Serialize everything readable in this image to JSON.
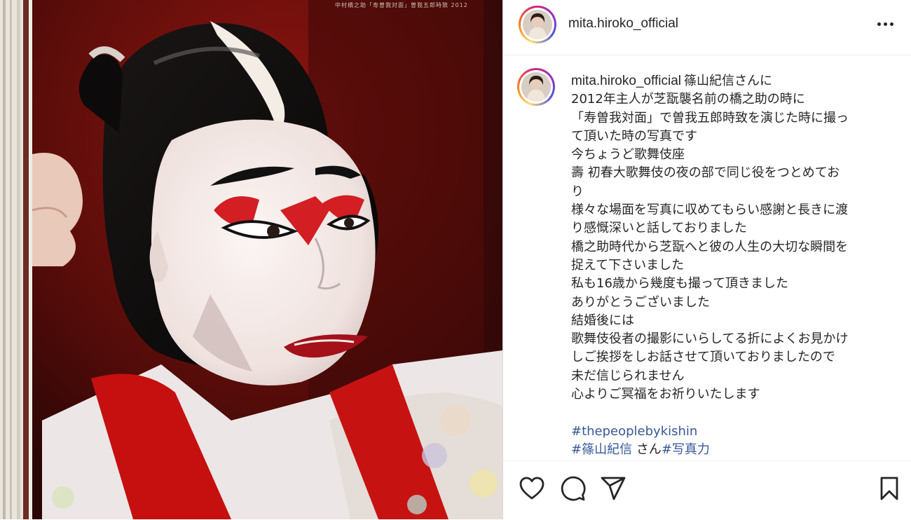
{
  "post": {
    "photo_caption": "中村橋之助「寿曽我対面」曽我五郎時致 2012",
    "header": {
      "avatar_icon": "profile-avatar",
      "username": "mita.hiroko_official",
      "more_icon": "more-options-icon"
    },
    "caption": {
      "username": "mita.hiroko_official",
      "lines": [
        "篠山紀信さんに",
        "2012年主人が芝翫襲名前の橋之助の時に",
        "「寿曽我対面」で曽我五郎時致を演じた時に撮っ",
        "て頂いた時の写真です",
        "今ちょうど歌舞伎座",
        "壽 初春大歌舞伎の夜の部で同じ役をつとめてお",
        "り",
        "様々な場面を写真に収めてもらい感謝と長きに渡",
        "り感慨深いと話しておりました",
        "橋之助時代から芝翫へと彼の人生の大切な瞬間を",
        "捉えて下さいました",
        "私も16歳から幾度も撮って頂きました",
        "ありがとうございました",
        "結婚後には",
        "歌舞伎役者の撮影にいらしてる折によくお見かけ",
        "しご挨拶をしお話させて頂いておりましたので",
        "未だ信じられません",
        "心よりご冥福をお祈りいたします"
      ],
      "hashtag_1": "#thepeoplebykishin",
      "hashtag_2": "#篠山紀信",
      "hashtag_2_suffix": " さん",
      "hashtag_3": "#写真力"
    },
    "actions": {
      "like_icon": "heart-icon",
      "comment_icon": "comment-icon",
      "share_icon": "share-icon",
      "save_icon": "bookmark-icon"
    },
    "colors": {
      "hashtag": "#385898",
      "text": "#262626",
      "divider": "#dbdbdb"
    }
  }
}
